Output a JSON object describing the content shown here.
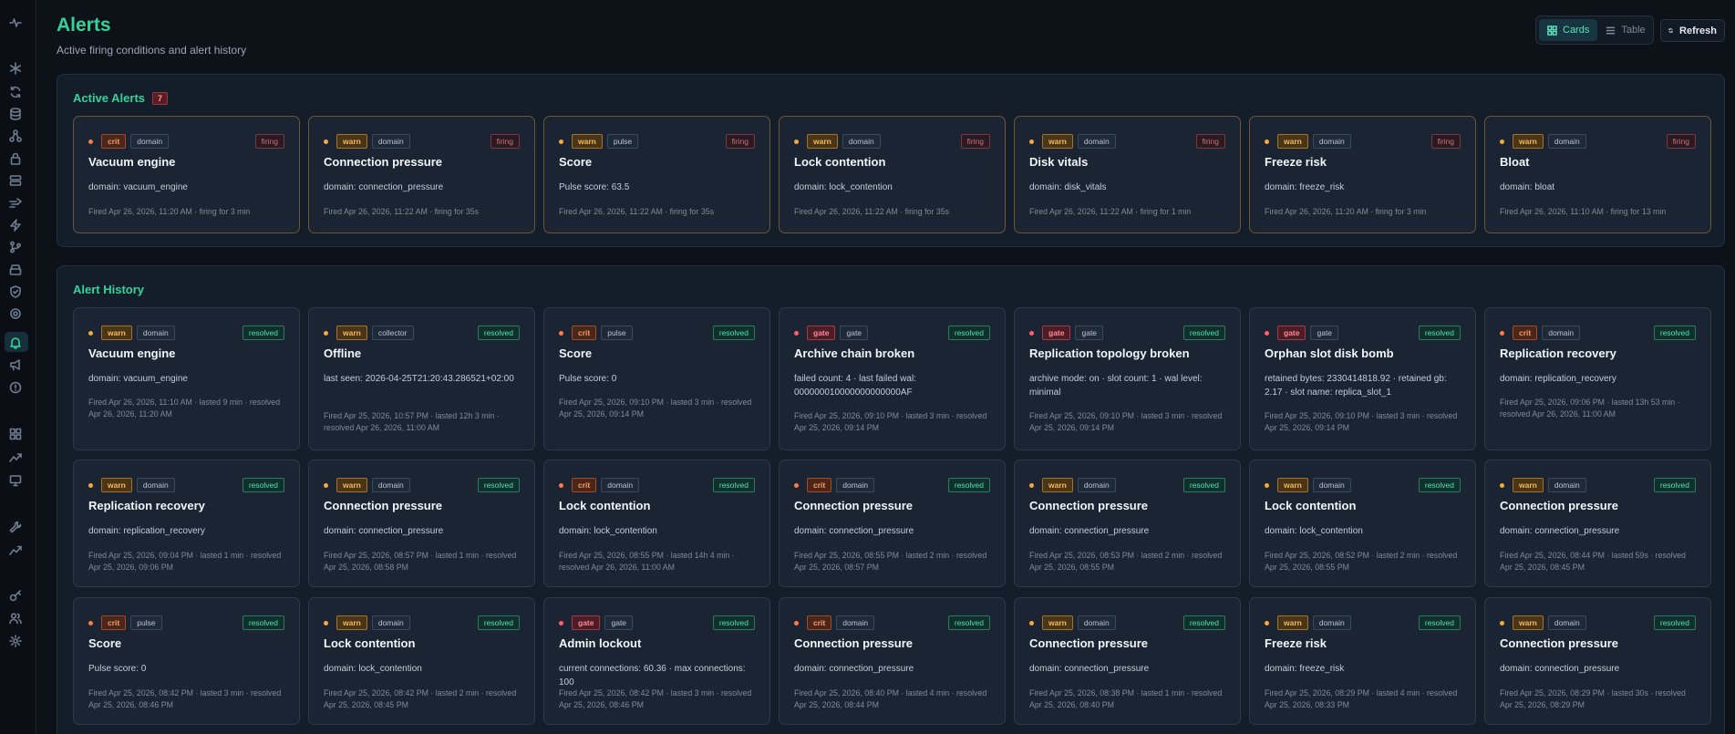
{
  "page": {
    "title": "Alerts",
    "subtitle": "Active firing conditions and alert history"
  },
  "view_toggle": {
    "cards_label": "Cards",
    "table_label": "Table",
    "selected": "Cards"
  },
  "refresh_label": "Refresh",
  "sidebar": {
    "icons": [
      "pulse-icon",
      "snowflake-icon",
      "refresh-cycle-icon",
      "database-icon",
      "network-icon",
      "lock-icon",
      "server-icon",
      "speed-icon",
      "lightning-icon",
      "git-branch-icon",
      "drive-icon",
      "shield-icon",
      "gear-icon",
      "bell-icon",
      "megaphone-icon",
      "alert-circle-icon",
      "grid-icon",
      "trend-icon",
      "monitor-icon",
      "wrench-icon",
      "trend-up-icon",
      "key-icon",
      "users-icon",
      "settings-icon"
    ],
    "active": "bell-icon"
  },
  "active_alerts": {
    "title": "Active Alerts",
    "count": "7",
    "cards": [
      {
        "severity": "crit",
        "category": "domain",
        "state": "firing",
        "title": "Vacuum engine",
        "detail": "domain: vacuum_engine",
        "footer": "Fired Apr 26, 2026, 11:20 AM · firing for 3 min"
      },
      {
        "severity": "warn",
        "category": "domain",
        "state": "firing",
        "title": "Connection pressure",
        "detail": "domain: connection_pressure",
        "footer": "Fired Apr 26, 2026, 11:22 AM · firing for 35s"
      },
      {
        "severity": "warn",
        "category": "pulse",
        "state": "firing",
        "title": "Score",
        "detail": "Pulse score: 63.5",
        "footer": "Fired Apr 26, 2026, 11:22 AM · firing for 35s"
      },
      {
        "severity": "warn",
        "category": "domain",
        "state": "firing",
        "title": "Lock contention",
        "detail": "domain: lock_contention",
        "footer": "Fired Apr 26, 2026, 11:22 AM · firing for 35s"
      },
      {
        "severity": "warn",
        "category": "domain",
        "state": "firing",
        "title": "Disk vitals",
        "detail": "domain: disk_vitals",
        "footer": "Fired Apr 26, 2026, 11:22 AM · firing for 1 min"
      },
      {
        "severity": "warn",
        "category": "domain",
        "state": "firing",
        "title": "Freeze risk",
        "detail": "domain: freeze_risk",
        "footer": "Fired Apr 26, 2026, 11:20 AM · firing for 3 min"
      },
      {
        "severity": "warn",
        "category": "domain",
        "state": "firing",
        "title": "Bloat",
        "detail": "domain: bloat",
        "footer": "Fired Apr 26, 2026, 11:10 AM · firing for 13 min"
      }
    ]
  },
  "alert_history": {
    "title": "Alert History",
    "rows": [
      [
        {
          "severity": "warn",
          "category": "domain",
          "state": "resolved",
          "title": "Vacuum engine",
          "detail": "domain: vacuum_engine",
          "footer": "Fired Apr 26, 2026, 11:10 AM · lasted 9 min · resolved Apr 26, 2026, 11:20 AM"
        },
        {
          "severity": "warn",
          "category": "collector",
          "state": "resolved",
          "title": "Offline",
          "detail": "last seen: 2026-04-25T21:20:43.286521+02:00",
          "footer": "Fired Apr 25, 2026, 10:57 PM · lasted 12h 3 min · resolved Apr 26, 2026, 11:00 AM"
        },
        {
          "severity": "crit",
          "category": "pulse",
          "state": "resolved",
          "title": "Score",
          "detail": "Pulse score: 0",
          "footer": "Fired Apr 25, 2026, 09:10 PM · lasted 3 min · resolved Apr 25, 2026, 09:14 PM"
        },
        {
          "severity": "gate",
          "category": "gate",
          "state": "resolved",
          "title": "Archive chain broken",
          "detail": "failed count: 4 · last failed wal: 000000010000000000000AF",
          "footer": "Fired Apr 25, 2026, 09:10 PM · lasted 3 min · resolved Apr 25, 2026, 09:14 PM"
        },
        {
          "severity": "gate",
          "category": "gate",
          "state": "resolved",
          "title": "Replication topology broken",
          "detail": "archive mode: on · slot count: 1 · wal level: minimal",
          "footer": "Fired Apr 25, 2026, 09:10 PM · lasted 3 min · resolved Apr 25, 2026, 09:14 PM"
        },
        {
          "severity": "gate",
          "category": "gate",
          "state": "resolved",
          "title": "Orphan slot disk bomb",
          "detail": "retained bytes: 2330414818.92 · retained gb: 2.17 · slot name: replica_slot_1",
          "footer": "Fired Apr 25, 2026, 09:10 PM · lasted 3 min · resolved Apr 25, 2026, 09:14 PM"
        },
        {
          "severity": "crit",
          "category": "domain",
          "state": "resolved",
          "title": "Replication recovery",
          "detail": "domain: replication_recovery",
          "footer": "Fired Apr 25, 2026, 09:06 PM · lasted 13h 53 min · resolved Apr 26, 2026, 11:00 AM"
        }
      ],
      [
        {
          "severity": "warn",
          "category": "domain",
          "state": "resolved",
          "title": "Replication recovery",
          "detail": "domain: replication_recovery",
          "footer": "Fired Apr 25, 2026, 09:04 PM · lasted 1 min · resolved Apr 25, 2026, 09:06 PM"
        },
        {
          "severity": "warn",
          "category": "domain",
          "state": "resolved",
          "title": "Connection pressure",
          "detail": "domain: connection_pressure",
          "footer": "Fired Apr 25, 2026, 08:57 PM · lasted 1 min · resolved Apr 25, 2026, 08:58 PM"
        },
        {
          "severity": "crit",
          "category": "domain",
          "state": "resolved",
          "title": "Lock contention",
          "detail": "domain: lock_contention",
          "footer": "Fired Apr 25, 2026, 08:55 PM · lasted 14h 4 min · resolved Apr 26, 2026, 11:00 AM"
        },
        {
          "severity": "crit",
          "category": "domain",
          "state": "resolved",
          "title": "Connection pressure",
          "detail": "domain: connection_pressure",
          "footer": "Fired Apr 25, 2026, 08:55 PM · lasted 2 min · resolved Apr 25, 2026, 08:57 PM"
        },
        {
          "severity": "warn",
          "category": "domain",
          "state": "resolved",
          "title": "Connection pressure",
          "detail": "domain: connection_pressure",
          "footer": "Fired Apr 25, 2026, 08:53 PM · lasted 2 min · resolved Apr 25, 2026, 08:55 PM"
        },
        {
          "severity": "warn",
          "category": "domain",
          "state": "resolved",
          "title": "Lock contention",
          "detail": "domain: lock_contention",
          "footer": "Fired Apr 25, 2026, 08:52 PM · lasted 2 min · resolved Apr 25, 2026, 08:55 PM"
        },
        {
          "severity": "warn",
          "category": "domain",
          "state": "resolved",
          "title": "Connection pressure",
          "detail": "domain: connection_pressure",
          "footer": "Fired Apr 25, 2026, 08:44 PM · lasted 59s · resolved Apr 25, 2026, 08:45 PM"
        }
      ],
      [
        {
          "severity": "crit",
          "category": "pulse",
          "state": "resolved",
          "title": "Score",
          "detail": "Pulse score: 0",
          "footer": "Fired Apr 25, 2026, 08:42 PM · lasted 3 min · resolved Apr 25, 2026, 08:46 PM"
        },
        {
          "severity": "warn",
          "category": "domain",
          "state": "resolved",
          "title": "Lock contention",
          "detail": "domain: lock_contention",
          "footer": "Fired Apr 25, 2026, 08:42 PM · lasted 2 min · resolved Apr 25, 2026, 08:45 PM"
        },
        {
          "severity": "gate",
          "category": "gate",
          "state": "resolved",
          "title": "Admin lockout",
          "detail": "current connections: 60.36 · max connections: 100",
          "footer": "Fired Apr 25, 2026, 08:42 PM · lasted 3 min · resolved Apr 25, 2026, 08:46 PM"
        },
        {
          "severity": "crit",
          "category": "domain",
          "state": "resolved",
          "title": "Connection pressure",
          "detail": "domain: connection_pressure",
          "footer": "Fired Apr 25, 2026, 08:40 PM · lasted 4 min · resolved Apr 25, 2026, 08:44 PM"
        },
        {
          "severity": "warn",
          "category": "domain",
          "state": "resolved",
          "title": "Connection pressure",
          "detail": "domain: connection_pressure",
          "footer": "Fired Apr 25, 2026, 08:38 PM · lasted 1 min · resolved Apr 25, 2026, 08:40 PM"
        },
        {
          "severity": "warn",
          "category": "domain",
          "state": "resolved",
          "title": "Freeze risk",
          "detail": "domain: freeze_risk",
          "footer": "Fired Apr 25, 2026, 08:29 PM · lasted 4 min · resolved Apr 25, 2026, 08:33 PM"
        },
        {
          "severity": "warn",
          "category": "domain",
          "state": "resolved",
          "title": "Connection pressure",
          "detail": "domain: connection_pressure",
          "footer": "Fired Apr 25, 2026, 08:29 PM · lasted 30s · resolved Apr 25, 2026, 08:29 PM"
        }
      ]
    ]
  },
  "colors": {
    "accent": "#34d399",
    "warn": "#f7bb5a",
    "crit": "#ff9a6d",
    "gate": "#ff8795",
    "resolved": "#4fe0b0",
    "firing": "#d26e7a"
  }
}
